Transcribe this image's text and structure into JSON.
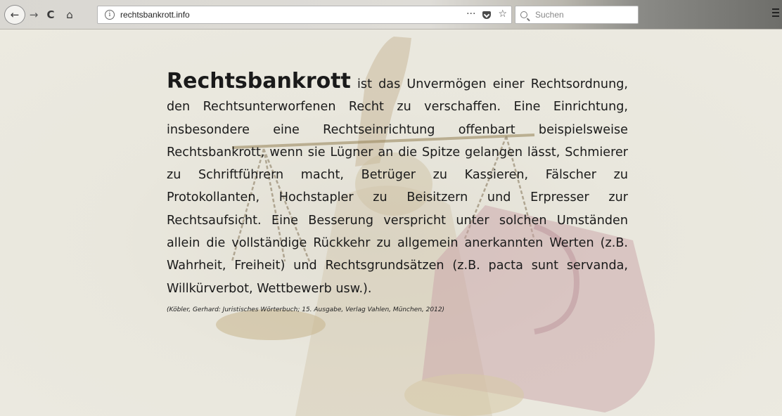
{
  "browser": {
    "back_glyph": "←",
    "forward_glyph": "→",
    "reload_glyph": "C",
    "home_glyph": "⌂",
    "info_glyph": "i",
    "url": "rechtsbankrott.info",
    "more_glyph": "···",
    "star_glyph": "☆",
    "search_placeholder": "Suchen"
  },
  "article": {
    "title": "Rechtsbankrott",
    "body": " ist das Unvermögen einer Rechtsordnung, den Rechtsunterworfenen Recht zu verschaffen. Eine Einrichtung, insbesondere eine Rechtseinrichtung offenbart beispielsweise Rechtsbankrott, wenn sie Lügner an die Spitze gelangen lässt, Schmierer zu Schriftführern macht, Betrüger zu Kassieren, Fälscher zu Protokollanten, Hochstapler zu Beisitzern und Erpresser zur Rechtsaufsicht. Eine Besserung verspricht unter solchen Umständen allein die vollständige Rückkehr zu allgemein anerkannten Werten (z.B. Wahrheit, Freiheit) und Rechtsgrundsätzen (z.B. pacta sunt servanda, Willkürverbot, Wettbewerb usw.).",
    "citation": "(Köbler, Gerhard: Juristisches Wörterbuch; 15. Ausgabe, Verlag Vahlen, München, 2012)"
  },
  "colors": {
    "page_background": "#eae8de",
    "text": "#1a1a1a",
    "banknote": "#c9a3a8"
  }
}
